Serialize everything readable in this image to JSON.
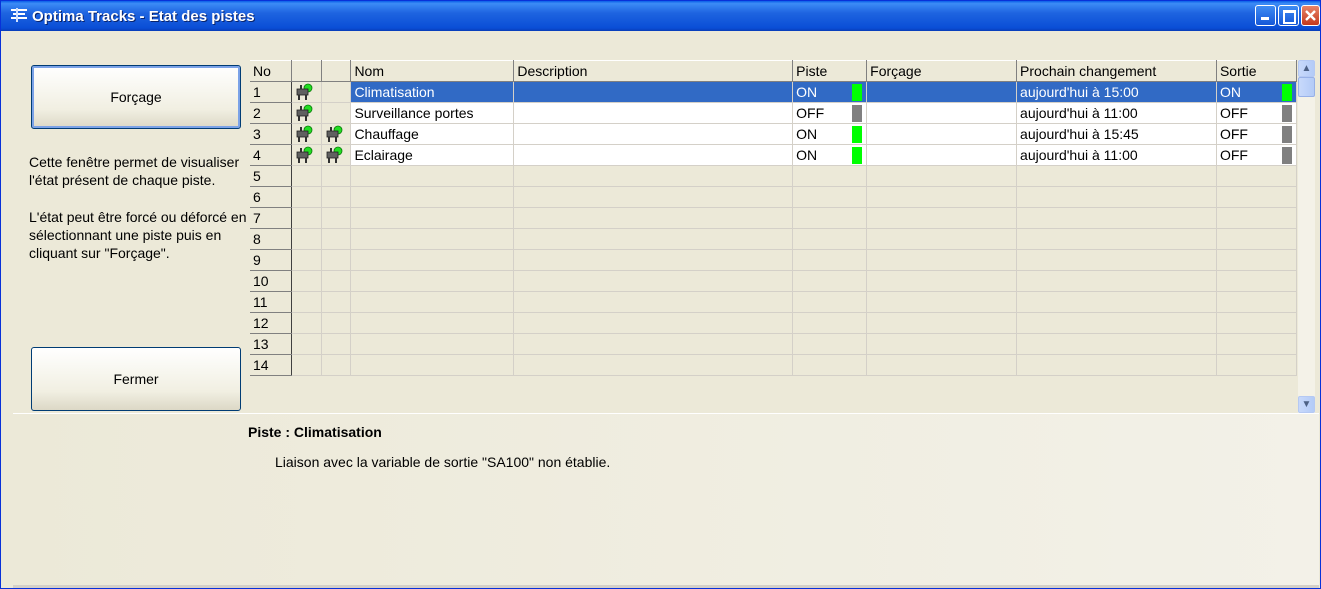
{
  "window": {
    "title": "Optima Tracks - Etat des pistes",
    "accent_color": "#0a4ed6",
    "selection_color": "#316ac5"
  },
  "sidebar": {
    "forcage_label": "Forçage",
    "fermer_label": "Fermer",
    "help_paragraph_1": "Cette fenêtre permet de visualiser l'état présent de chaque piste.",
    "help_paragraph_2": "L'état peut être forcé ou déforcé en sélectionnant une piste puis en cliquant sur \"Forçage\"."
  },
  "grid": {
    "headers": {
      "no": "No",
      "icon1": "",
      "icon2": "",
      "nom": "Nom",
      "description": "Description",
      "piste": "Piste",
      "forcage": "Forçage",
      "prochain": "Prochain changement",
      "sortie": "Sortie"
    },
    "rows": [
      {
        "no": "1",
        "nom": "Climatisation",
        "description": "",
        "piste": "ON",
        "piste_on": true,
        "forcage": "",
        "prochain": "aujourd'hui à 15:00",
        "sortie": "ON",
        "sortie_on": true,
        "icon1": "plug-green-icon",
        "icon2": "",
        "selected": true
      },
      {
        "no": "2",
        "nom": "Surveillance portes",
        "description": "",
        "piste": "OFF",
        "piste_on": false,
        "forcage": "",
        "prochain": "aujourd'hui à 11:00",
        "sortie": "OFF",
        "sortie_on": false,
        "icon1": "plug-green-icon",
        "icon2": "",
        "selected": false
      },
      {
        "no": "3",
        "nom": "Chauffage",
        "description": "",
        "piste": "ON",
        "piste_on": true,
        "forcage": "",
        "prochain": "aujourd'hui à 15:45",
        "sortie": "OFF",
        "sortie_on": false,
        "icon1": "plug-green-icon",
        "icon2": "plug-green-icon",
        "selected": false
      },
      {
        "no": "4",
        "nom": "Eclairage",
        "description": "",
        "piste": "ON",
        "piste_on": true,
        "forcage": "",
        "prochain": "aujourd'hui à 11:00",
        "sortie": "OFF",
        "sortie_on": false,
        "icon1": "plug-green-icon",
        "icon2": "plug-green-icon",
        "selected": false
      }
    ],
    "empty_row_numbers": [
      "5",
      "6",
      "7",
      "8",
      "9",
      "10",
      "11",
      "12",
      "13",
      "14"
    ]
  },
  "detail": {
    "title": "Piste : Climatisation",
    "message": "Liaison avec la variable de sortie \"SA100\" non établie."
  }
}
